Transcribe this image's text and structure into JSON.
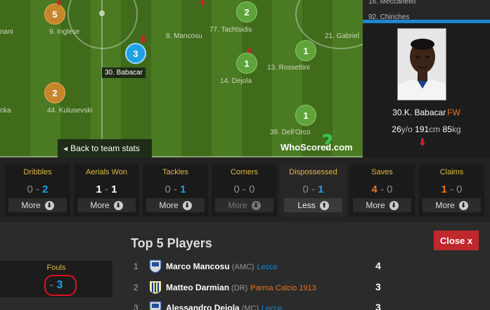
{
  "pitch": {
    "players": [
      {
        "id": "5",
        "num": "5",
        "label": "9. Inglese",
        "style": "orange"
      },
      {
        "id": "2a",
        "num": "2",
        "label": "77. Tachtsidis",
        "style": "green"
      },
      {
        "id": "3",
        "num": "3",
        "label": "30. Babacar",
        "style": "blue"
      },
      {
        "id": "1a",
        "num": "1",
        "label": "14. Dejola",
        "style": "green"
      },
      {
        "id": "1b",
        "num": "1",
        "label": "13. Rossettini",
        "style": "green"
      },
      {
        "id": "2b",
        "num": "2",
        "label": "44. Kulusevski",
        "style": "orange"
      },
      {
        "id": "1c",
        "num": "1",
        "label": "39. Dell'Orco",
        "style": "green"
      }
    ],
    "plain_labels": {
      "mancosu": "8. Mancosu",
      "gabriel": "21. Gabriel",
      "left_top": "nani",
      "left_mid": "cka"
    },
    "back_button": "Back to team stats",
    "logo_text": "WhoScored",
    "logo_suffix": ".com"
  },
  "panel": {
    "top_names": [
      "16. Meccariello",
      "92. Chiriches"
    ],
    "player_name": "30.K. Babacar",
    "position": "FW",
    "age": "26",
    "age_unit": "y/o",
    "height": "191",
    "height_unit": "cm",
    "weight": "85",
    "weight_unit": "kg"
  },
  "stats": [
    {
      "label": "Dribbles",
      "left": "0",
      "right": "2",
      "more": "More"
    },
    {
      "label": "Aerials Won",
      "left": "1",
      "right": "1",
      "more": "More"
    },
    {
      "label": "Tackles",
      "left": "0",
      "right": "1",
      "more": "More"
    },
    {
      "label": "Corners",
      "left": "0",
      "right": "0",
      "more": "More"
    },
    {
      "label": "Dispossessed",
      "left": "0",
      "right": "1",
      "more": "Less"
    },
    {
      "label": "Saves",
      "left": "4",
      "right": "0",
      "more": "More"
    },
    {
      "label": "Claims",
      "left": "1",
      "right": "0",
      "more": "More"
    }
  ],
  "fouls": {
    "label": "Fouls",
    "left": "-",
    "right": "3"
  },
  "top5": {
    "title": "Top 5 Players",
    "close": "Close x",
    "rows": [
      {
        "rank": "1",
        "name": "Marco Mancosu",
        "role": "(AMC)",
        "team": "Lecce",
        "score": "4"
      },
      {
        "rank": "2",
        "name": "Matteo Darmian",
        "role": "(DR)",
        "team": "Parma Calcio 1913",
        "score": "3"
      },
      {
        "rank": "3",
        "name": "Alessandro Deiola",
        "role": "(MC)",
        "team": "Lecce",
        "score": "3"
      }
    ]
  },
  "colors": {
    "accent_blue": "#1ea1e6",
    "accent_orange": "#e87522",
    "label_gold": "#e0b845",
    "close_red": "#c0282c"
  }
}
